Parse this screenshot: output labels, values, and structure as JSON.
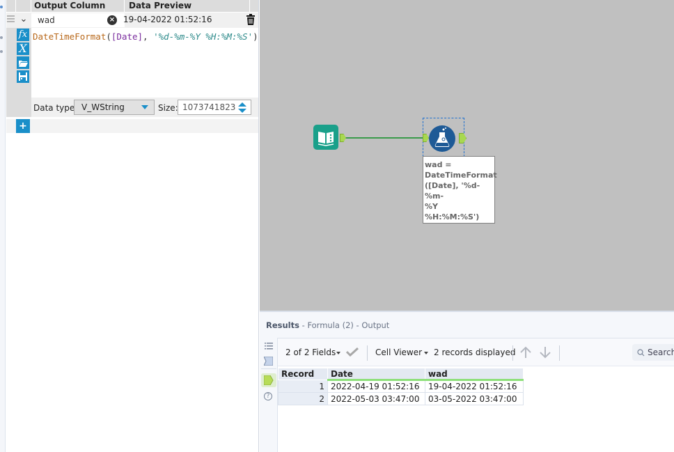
{
  "formula_config": {
    "headers": {
      "output_column": "Output Column",
      "data_preview": "Data Preview"
    },
    "expression": {
      "output_name": "wad",
      "preview_value": "19-04-2022 01:52:16",
      "formula": {
        "function": "DateTimeFormat",
        "open": "(",
        "field": "[Date]",
        "comma": ", ",
        "format_string": "'%d-%m-%Y %H:%M:%S'",
        "close": ")"
      },
      "editor_icons": [
        "fx-icon",
        "variable-x-icon",
        "open-folder-icon",
        "save-icon"
      ],
      "data_type_label": "Data type:",
      "data_type_value": "V_WString",
      "size_label": "Size:",
      "size_value": "1073741823"
    },
    "add_button_label": "+"
  },
  "canvas": {
    "tools": [
      {
        "id": "input-data",
        "type": "Input Data"
      },
      {
        "id": "formula",
        "type": "Formula"
      }
    ],
    "annotation_lines": [
      "wad =",
      "DateTimeFormat",
      "([Date], '%d-%m-",
      "%Y %H:%M:%S')"
    ]
  },
  "results": {
    "title_bold": "Results",
    "title_rest": " - Formula (2) - Output",
    "toolbar": {
      "fields_label": "2 of 2 Fields",
      "viewer_label": "Cell Viewer",
      "records_label": "2 records displayed",
      "search_placeholder": "Search"
    },
    "columns": [
      "Record",
      "Date",
      "wad"
    ],
    "rows": [
      {
        "record": "1",
        "date": "2022-04-19 01:52:16",
        "wad": "19-04-2022 01:52:16"
      },
      {
        "record": "2",
        "date": "2022-05-03 03:47:00",
        "wad": "03-05-2022 03:47:00"
      }
    ],
    "colors": {
      "header_underline": "#8ee07a",
      "accent": "#1a8fc9"
    }
  }
}
